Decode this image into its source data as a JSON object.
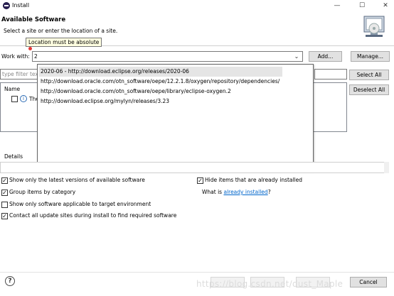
{
  "window": {
    "title": "Install",
    "minimize_glyph": "—",
    "maximize_glyph": "☐",
    "close_glyph": "✕"
  },
  "banner": {
    "title": "Available Software",
    "subtitle": "Select a site or enter the location of a site."
  },
  "tooltip": {
    "text": "Location must be absolute"
  },
  "work_with": {
    "label": "Work with:",
    "value": "2",
    "add_label": "Add...",
    "manage_label": "Manage..."
  },
  "dropdown": {
    "items": [
      "2020-06 - http://download.eclipse.org/releases/2020-06",
      "http://download.oracle.com/otn_software/oepe/12.2.1.8/oxygen/repository/dependencies/",
      "http://download.oracle.com/otn_software/oepe/library/eclipse-oxygen.2",
      "http://download.eclipse.org/mylyn/releases/3.23"
    ],
    "selected_index": 0
  },
  "filter": {
    "placeholder": "type filter tex"
  },
  "tree": {
    "column_name": "Name",
    "row_text": "The"
  },
  "side_buttons": {
    "select_all": "Select All",
    "deselect_all": "Deselect All"
  },
  "details": {
    "label": "Details"
  },
  "options": {
    "latest_versions": {
      "label": "Show only the latest versions of available software",
      "checked": true
    },
    "group_by_category": {
      "label": "Group items by category",
      "checked": true
    },
    "target_env": {
      "label": "Show only software applicable to target environment",
      "checked": false
    },
    "contact_sites": {
      "label": "Contact all update sites during install to find required software",
      "checked": true
    },
    "hide_installed": {
      "label": "Hide items that are already installed",
      "checked": true
    }
  },
  "installed_link": {
    "prefix": "What is ",
    "link": "already installed",
    "suffix": "?"
  },
  "footer": {
    "help_glyph": "?",
    "cancel_label": "Cancel",
    "watermark": "https://blog.csdn.net/dust_Maple"
  },
  "colors": {
    "link": "#0066cc",
    "tooltip_bg": "#ffffe1",
    "error": "#e53935"
  }
}
